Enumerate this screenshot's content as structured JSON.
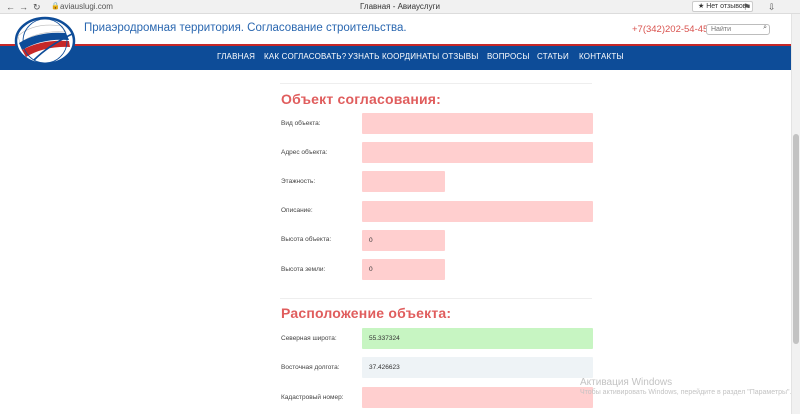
{
  "browser": {
    "url": "aviauslugi.com",
    "tab_title": "Главная - Авиауслуги",
    "reviews_label": "★ Нет отзывов"
  },
  "header": {
    "site_title": "Приаэродромная территория. Согласование строительства.",
    "phone": "+7(342)202-54-45",
    "search_placeholder": "Найти"
  },
  "nav": {
    "items": [
      {
        "label": "ГЛАВНАЯ"
      },
      {
        "label": "КАК СОГЛАСОВАТЬ?"
      },
      {
        "label": "УЗНАТЬ КООРДИНАТЫ"
      },
      {
        "label": "ОТЗЫВЫ"
      },
      {
        "label": "ВОПРОСЫ"
      },
      {
        "label": "СТАТЬИ"
      },
      {
        "label": "КОНТАКТЫ"
      }
    ]
  },
  "form": {
    "object_section": {
      "title": "Объект согласования:",
      "fields": {
        "type": {
          "label": "Вид объекта:",
          "value": ""
        },
        "address": {
          "label": "Адрес объекта:",
          "value": ""
        },
        "floors": {
          "label": "Этажность:",
          "value": ""
        },
        "description": {
          "label": "Описание:",
          "value": ""
        },
        "height": {
          "label": "Высота объекта:",
          "value": "0"
        },
        "ground": {
          "label": "Высота земли:",
          "value": "0"
        }
      }
    },
    "location_section": {
      "title": "Расположение объекта:",
      "fields": {
        "latitude": {
          "label": "Северная широта:",
          "value": "55.337324"
        },
        "longitude": {
          "label": "Восточная долгота:",
          "value": "37.426623"
        },
        "cadastral": {
          "label": "Кадастровый номер:",
          "value": ""
        }
      }
    }
  },
  "watermark": {
    "title": "Активация Windows",
    "subtitle": "Чтобы активировать Windows, перейдите в раздел \"Параметры\"."
  },
  "colors": {
    "brand_blue": "#0d4c98",
    "accent_red": "#e05d5d",
    "field_pink": "#ffcfcf",
    "field_green": "#c7f5c2"
  }
}
